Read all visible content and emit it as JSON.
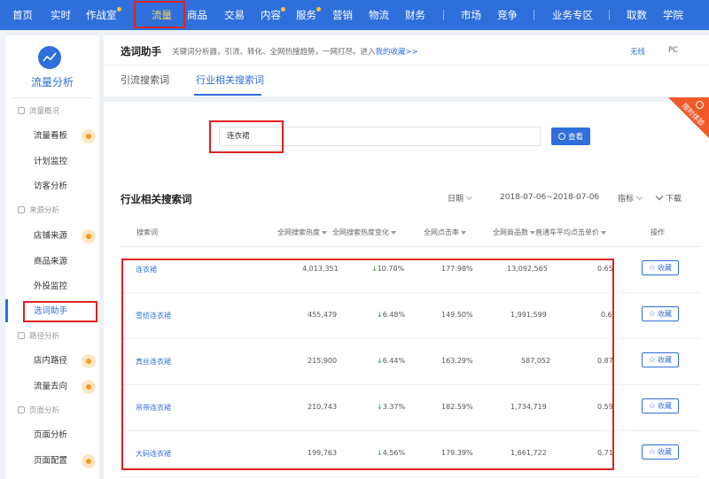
{
  "nav": {
    "items": [
      {
        "label": "首页"
      },
      {
        "label": "实时"
      },
      {
        "label": "作战室"
      },
      {
        "label": "流量"
      },
      {
        "label": "商品"
      },
      {
        "label": "交易"
      },
      {
        "label": "内容"
      },
      {
        "label": "服务"
      },
      {
        "label": "营销"
      },
      {
        "label": "物流"
      },
      {
        "label": "财务"
      },
      {
        "label": "市场"
      },
      {
        "label": "竞争"
      },
      {
        "label": "业务专区"
      },
      {
        "label": "取数"
      },
      {
        "label": "学院"
      }
    ],
    "active": "流量"
  },
  "sidebar": {
    "title": "流量分析",
    "sections": [
      {
        "header": "流量概况",
        "items": [
          "流量看板",
          "计划监控",
          "访客分析"
        ]
      },
      {
        "header": "来源分析",
        "items": [
          "店铺来源",
          "商品来源",
          "外投监控",
          "选词助手"
        ]
      },
      {
        "header": "路径分析",
        "items": [
          "店内路径",
          "流量去向"
        ]
      },
      {
        "header": "页面分析",
        "items": [
          "页面分析",
          "页面配置"
        ]
      }
    ],
    "active": "选词助手"
  },
  "main": {
    "title": "选词助手",
    "description_prefix": "关键词分析器，引流、转化、全网热搜趋势，一网打尽。进入",
    "description_link": "我的收藏>>",
    "header_right": [
      "无线",
      "PC"
    ],
    "tabs": [
      "引流搜索词",
      "行业相关搜索词"
    ],
    "active_tab": "行业相关搜索词",
    "search": {
      "value": "连衣裙",
      "button_label": "查看"
    },
    "ribbon_text": "限时体验",
    "section_title": "行业相关搜索词",
    "date_label": "日期",
    "date_range": "2018-07-06~2018-07-06",
    "metric_label": "指标",
    "download_label": "下载",
    "table": {
      "columns": [
        "搜索词",
        "全网搜索热度",
        "全网搜索热度变化",
        "全网点击率",
        "全网商品数",
        "直通车平均点击单价",
        "操作"
      ],
      "rows": [
        {
          "keyword": "连衣裙",
          "heat": "4,013,351",
          "change": "10.70%",
          "ctr": "177.98%",
          "products": "13,092,565",
          "cpc": "0.65",
          "action": "收藏"
        },
        {
          "keyword": "雪纺连衣裙",
          "heat": "455,479",
          "change": "6.48%",
          "ctr": "149.50%",
          "products": "1,991,599",
          "cpc": "0.6",
          "action": "收藏"
        },
        {
          "keyword": "真丝连衣裙",
          "heat": "215,900",
          "change": "6.44%",
          "ctr": "163.29%",
          "products": "587,052",
          "cpc": "0.87",
          "action": "收藏"
        },
        {
          "keyword": "吊带连衣裙",
          "heat": "210,743",
          "change": "3.37%",
          "ctr": "182.59%",
          "products": "1,734,719",
          "cpc": "0.59",
          "action": "收藏"
        },
        {
          "keyword": "大码连衣裙",
          "heat": "199,763",
          "change": "4.56%",
          "ctr": "179.39%",
          "products": "1,661,722",
          "cpc": "0.71",
          "action": "收藏"
        }
      ]
    }
  },
  "colors": {
    "brand": "#2f6fdc",
    "highlight": "#e02020",
    "badge": "#f59a23",
    "decrease": "#2a9d3f"
  }
}
